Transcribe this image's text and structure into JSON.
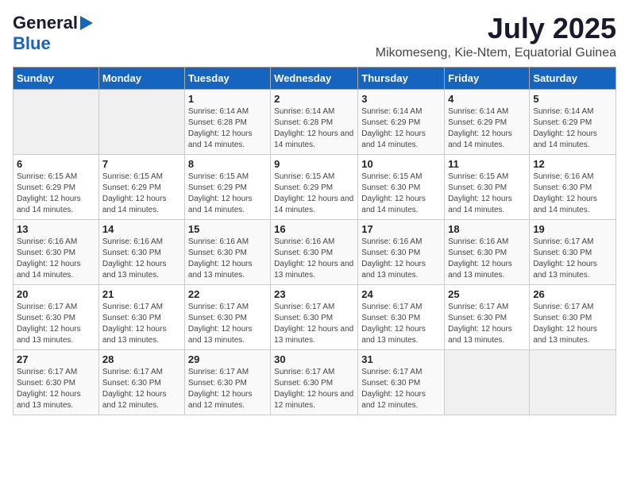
{
  "logo": {
    "line1": "General",
    "line2": "Blue"
  },
  "header": {
    "month_year": "July 2025",
    "location": "Mikomeseng, Kie-Ntem, Equatorial Guinea"
  },
  "days_of_week": [
    "Sunday",
    "Monday",
    "Tuesday",
    "Wednesday",
    "Thursday",
    "Friday",
    "Saturday"
  ],
  "weeks": [
    [
      {
        "day": "",
        "info": ""
      },
      {
        "day": "",
        "info": ""
      },
      {
        "day": "1",
        "info": "Sunrise: 6:14 AM\nSunset: 6:28 PM\nDaylight: 12 hours and 14 minutes."
      },
      {
        "day": "2",
        "info": "Sunrise: 6:14 AM\nSunset: 6:28 PM\nDaylight: 12 hours and 14 minutes."
      },
      {
        "day": "3",
        "info": "Sunrise: 6:14 AM\nSunset: 6:29 PM\nDaylight: 12 hours and 14 minutes."
      },
      {
        "day": "4",
        "info": "Sunrise: 6:14 AM\nSunset: 6:29 PM\nDaylight: 12 hours and 14 minutes."
      },
      {
        "day": "5",
        "info": "Sunrise: 6:14 AM\nSunset: 6:29 PM\nDaylight: 12 hours and 14 minutes."
      }
    ],
    [
      {
        "day": "6",
        "info": "Sunrise: 6:15 AM\nSunset: 6:29 PM\nDaylight: 12 hours and 14 minutes."
      },
      {
        "day": "7",
        "info": "Sunrise: 6:15 AM\nSunset: 6:29 PM\nDaylight: 12 hours and 14 minutes."
      },
      {
        "day": "8",
        "info": "Sunrise: 6:15 AM\nSunset: 6:29 PM\nDaylight: 12 hours and 14 minutes."
      },
      {
        "day": "9",
        "info": "Sunrise: 6:15 AM\nSunset: 6:29 PM\nDaylight: 12 hours and 14 minutes."
      },
      {
        "day": "10",
        "info": "Sunrise: 6:15 AM\nSunset: 6:30 PM\nDaylight: 12 hours and 14 minutes."
      },
      {
        "day": "11",
        "info": "Sunrise: 6:15 AM\nSunset: 6:30 PM\nDaylight: 12 hours and 14 minutes."
      },
      {
        "day": "12",
        "info": "Sunrise: 6:16 AM\nSunset: 6:30 PM\nDaylight: 12 hours and 14 minutes."
      }
    ],
    [
      {
        "day": "13",
        "info": "Sunrise: 6:16 AM\nSunset: 6:30 PM\nDaylight: 12 hours and 14 minutes."
      },
      {
        "day": "14",
        "info": "Sunrise: 6:16 AM\nSunset: 6:30 PM\nDaylight: 12 hours and 13 minutes."
      },
      {
        "day": "15",
        "info": "Sunrise: 6:16 AM\nSunset: 6:30 PM\nDaylight: 12 hours and 13 minutes."
      },
      {
        "day": "16",
        "info": "Sunrise: 6:16 AM\nSunset: 6:30 PM\nDaylight: 12 hours and 13 minutes."
      },
      {
        "day": "17",
        "info": "Sunrise: 6:16 AM\nSunset: 6:30 PM\nDaylight: 12 hours and 13 minutes."
      },
      {
        "day": "18",
        "info": "Sunrise: 6:16 AM\nSunset: 6:30 PM\nDaylight: 12 hours and 13 minutes."
      },
      {
        "day": "19",
        "info": "Sunrise: 6:17 AM\nSunset: 6:30 PM\nDaylight: 12 hours and 13 minutes."
      }
    ],
    [
      {
        "day": "20",
        "info": "Sunrise: 6:17 AM\nSunset: 6:30 PM\nDaylight: 12 hours and 13 minutes."
      },
      {
        "day": "21",
        "info": "Sunrise: 6:17 AM\nSunset: 6:30 PM\nDaylight: 12 hours and 13 minutes."
      },
      {
        "day": "22",
        "info": "Sunrise: 6:17 AM\nSunset: 6:30 PM\nDaylight: 12 hours and 13 minutes."
      },
      {
        "day": "23",
        "info": "Sunrise: 6:17 AM\nSunset: 6:30 PM\nDaylight: 12 hours and 13 minutes."
      },
      {
        "day": "24",
        "info": "Sunrise: 6:17 AM\nSunset: 6:30 PM\nDaylight: 12 hours and 13 minutes."
      },
      {
        "day": "25",
        "info": "Sunrise: 6:17 AM\nSunset: 6:30 PM\nDaylight: 12 hours and 13 minutes."
      },
      {
        "day": "26",
        "info": "Sunrise: 6:17 AM\nSunset: 6:30 PM\nDaylight: 12 hours and 13 minutes."
      }
    ],
    [
      {
        "day": "27",
        "info": "Sunrise: 6:17 AM\nSunset: 6:30 PM\nDaylight: 12 hours and 13 minutes."
      },
      {
        "day": "28",
        "info": "Sunrise: 6:17 AM\nSunset: 6:30 PM\nDaylight: 12 hours and 12 minutes."
      },
      {
        "day": "29",
        "info": "Sunrise: 6:17 AM\nSunset: 6:30 PM\nDaylight: 12 hours and 12 minutes."
      },
      {
        "day": "30",
        "info": "Sunrise: 6:17 AM\nSunset: 6:30 PM\nDaylight: 12 hours and 12 minutes."
      },
      {
        "day": "31",
        "info": "Sunrise: 6:17 AM\nSunset: 6:30 PM\nDaylight: 12 hours and 12 minutes."
      },
      {
        "day": "",
        "info": ""
      },
      {
        "day": "",
        "info": ""
      }
    ]
  ]
}
